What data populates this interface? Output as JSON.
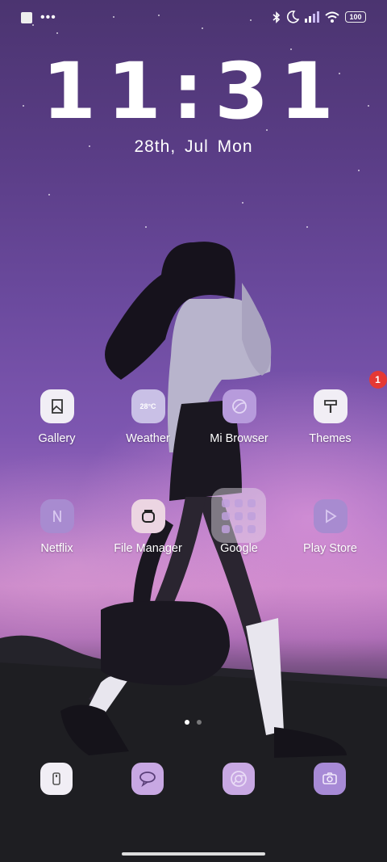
{
  "status_bar": {
    "battery": "100",
    "left_icons": [
      "notification-square-icon",
      "more-dots-icon"
    ],
    "right_icons": [
      "bluetooth-icon",
      "moon-icon",
      "signal-icon",
      "wifi-icon",
      "battery-icon"
    ]
  },
  "clock": {
    "time": "11:31",
    "date": "28th,  Jul   Mon"
  },
  "apps_row1": [
    {
      "label": "Gallery",
      "icon": "gallery-icon"
    },
    {
      "label": "Weather",
      "icon": "weather-icon",
      "icon_text": "28°C"
    },
    {
      "label": "Mi Browser",
      "icon": "browser-icon"
    },
    {
      "label": "Themes",
      "icon": "themes-icon",
      "badge": "1"
    }
  ],
  "apps_row2": [
    {
      "label": "Netflix",
      "icon": "netflix-icon"
    },
    {
      "label": "File Manager",
      "icon": "file-manager-icon"
    },
    {
      "label": "Google",
      "icon": "folder-icon"
    },
    {
      "label": "Play Store",
      "icon": "play-store-icon"
    }
  ],
  "pager": {
    "pages": 2,
    "active": 1
  },
  "dock": [
    "phone-icon",
    "messages-icon",
    "chrome-icon",
    "camera-icon"
  ],
  "colors": {
    "badge": "#e53935",
    "icon_tint": "#c9b3e6"
  }
}
